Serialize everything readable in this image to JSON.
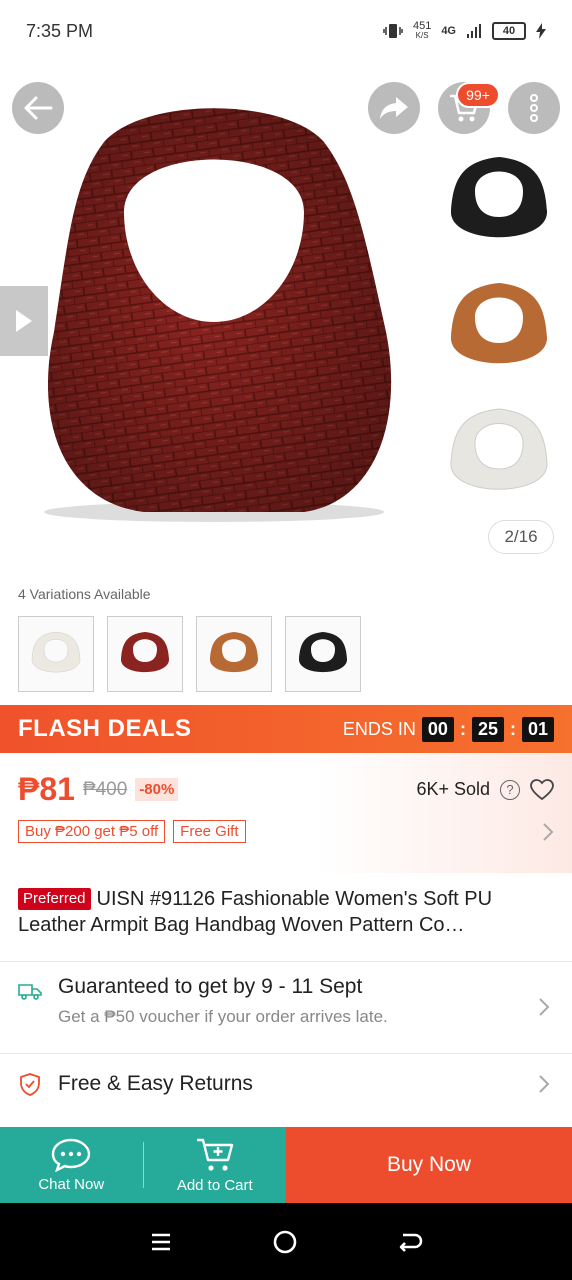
{
  "status": {
    "time": "7:35 PM",
    "speed_value": "451",
    "speed_unit": "K/S",
    "network": "4G",
    "battery": "40"
  },
  "hero": {
    "counter": "2/16",
    "cart_badge": "99+",
    "main_color": "#8b2420",
    "thumb_colors": [
      "#1d1d1d",
      "#b86a35",
      "#e8e6e0"
    ]
  },
  "variations": {
    "label": "4 Variations Available",
    "items": [
      {
        "color": "#ece9e2"
      },
      {
        "color": "#8b2420"
      },
      {
        "color": "#b86a35"
      },
      {
        "color": "#1d1d1d"
      }
    ]
  },
  "flash": {
    "title": "FLASH DEALS",
    "ends_label": "ENDS IN",
    "hours": "00",
    "minutes": "25",
    "seconds": "01"
  },
  "price": {
    "current": "₱81",
    "original": "₱400",
    "discount": "-80%",
    "sold": "6K+ Sold",
    "promo1": "Buy ₱200 get ₱5 off",
    "promo2": "Free Gift"
  },
  "product": {
    "badge": "Preferred",
    "title": "UISN #91126 Fashionable Women's Soft PU Leather Armpit Bag Handbag Woven Pattern Co…"
  },
  "shipping": {
    "line1": "Guaranteed to get by 9 - 11 Sept",
    "line2": "Get a ₱50 voucher if your order arrives late."
  },
  "returns": {
    "label": "Free & Easy Returns"
  },
  "bottom": {
    "chat": "Chat Now",
    "cart": "Add to Cart",
    "buy": "Buy Now"
  },
  "colors": {
    "accent": "#ee4d2d",
    "teal": "#26aa99"
  }
}
